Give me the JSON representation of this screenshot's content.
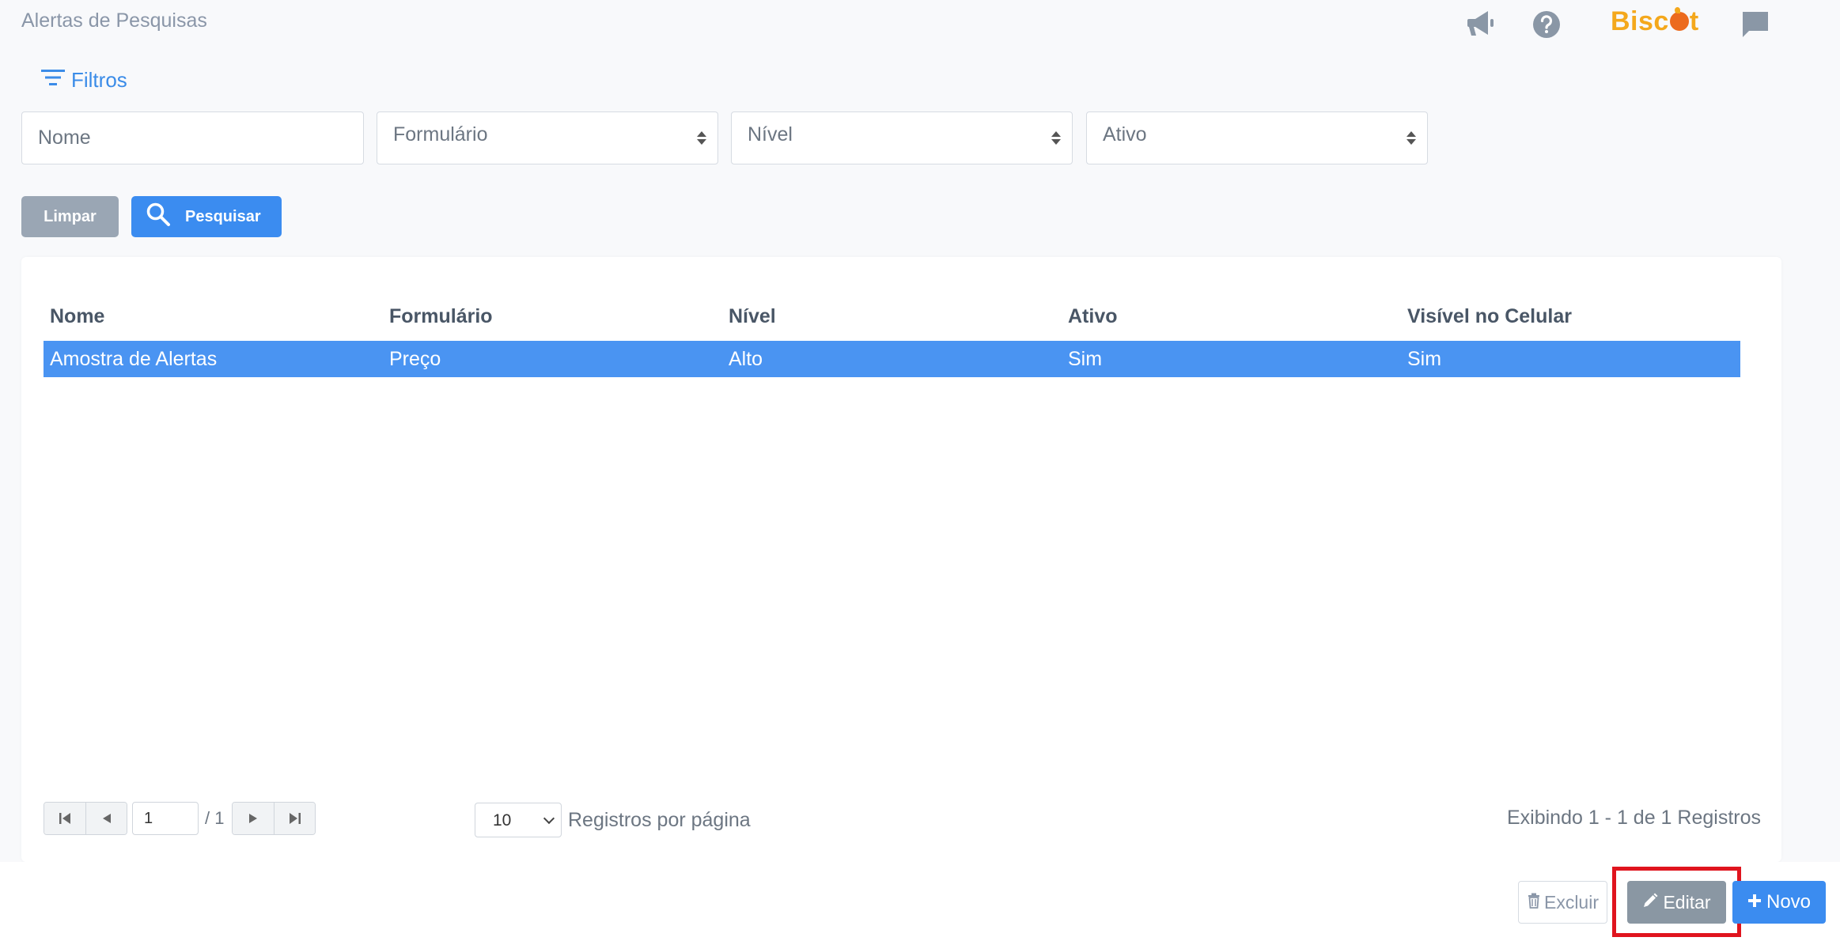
{
  "header": {
    "title": "Alertas de Pesquisas",
    "brand": {
      "text_before": "Bisc",
      "text_after": "t"
    },
    "icons": [
      "megaphone-icon",
      "help-icon",
      "chat-icon"
    ]
  },
  "filters": {
    "toggle_label": "Filtros",
    "nome_placeholder": "Nome",
    "formulario_placeholder": "Formulário",
    "nivel_placeholder": "Nível",
    "ativo_placeholder": "Ativo",
    "clear_label": "Limpar",
    "search_label": "Pesquisar"
  },
  "table": {
    "columns": [
      "Nome",
      "Formulário",
      "Nível",
      "Ativo",
      "Visível no Celular"
    ],
    "rows": [
      [
        "Amostra de Alertas",
        "Preço",
        "Alto",
        "Sim",
        "Sim"
      ]
    ]
  },
  "pagination": {
    "current_page": "1",
    "total_pages": "/ 1",
    "per_page": "10",
    "per_page_label": "Registros por página",
    "record_info": "Exibindo 1 - 1 de 1 Registros"
  },
  "actions": {
    "excluir_label": "Excluir",
    "editar_label": "Editar",
    "novo_label": "Novo"
  },
  "colors": {
    "primary": "#3b8cf0",
    "selected_row": "#4a94f2",
    "brand": "#f4a81c",
    "highlight": "#e0141e"
  }
}
